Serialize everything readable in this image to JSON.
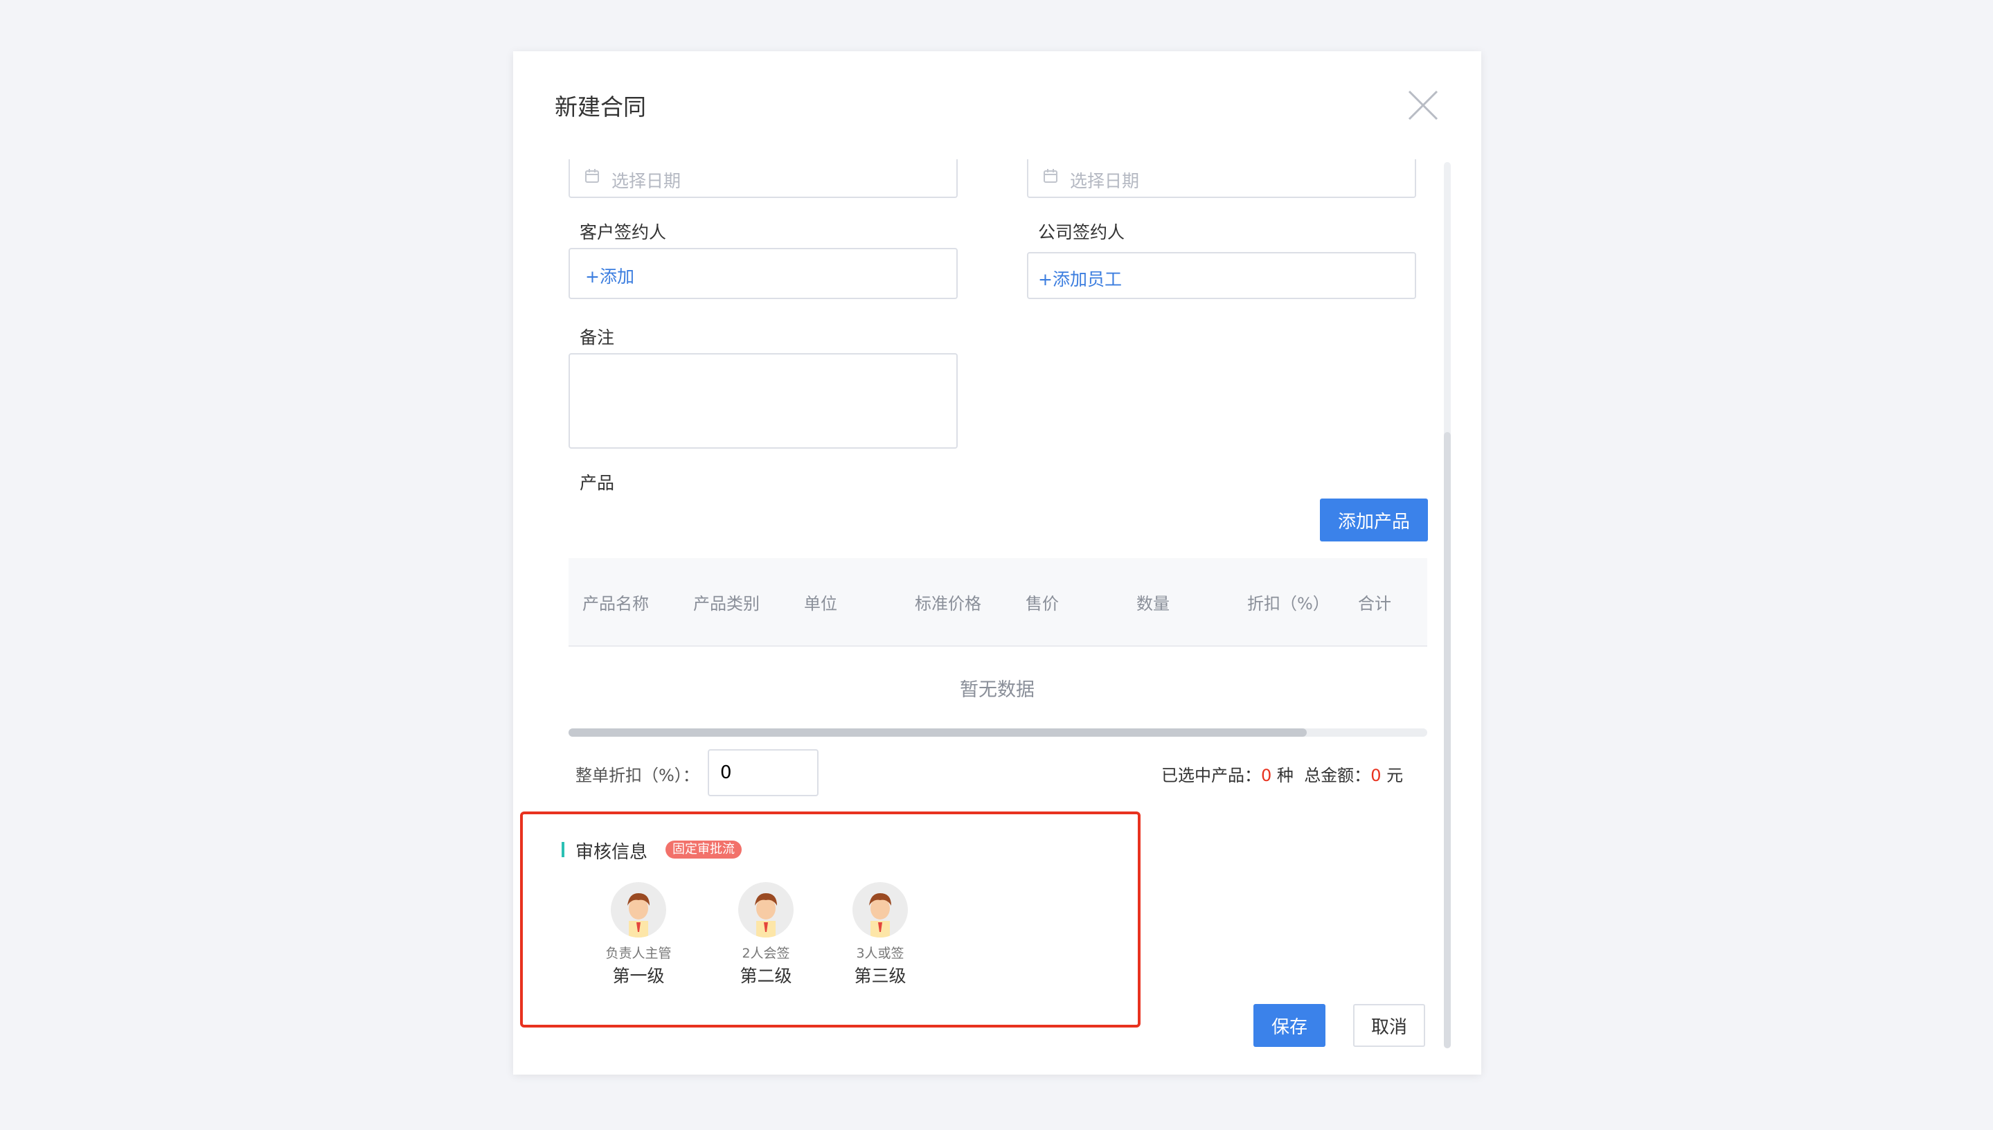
{
  "modal": {
    "title": "新建合同",
    "close_icon": "close-icon"
  },
  "form": {
    "date_placeholder_left": "选择日期",
    "date_placeholder_right": "选择日期",
    "customer_signer_label": "客户签约人",
    "customer_signer_add": "+添加",
    "company_signer_label": "公司签约人",
    "company_signer_add": "+添加员工",
    "remark_label": "备注",
    "remark_value": "",
    "product_label": "产品",
    "add_product_button": "添加产品"
  },
  "table": {
    "columns": [
      "产品名称",
      "产品类别",
      "单位",
      "标准价格",
      "售价",
      "数量",
      "折扣（%）",
      "合计"
    ],
    "empty_text": "暂无数据"
  },
  "summary": {
    "discount_label": "整单折扣（%）：",
    "discount_value": "0",
    "selected_label": "已选中产品：",
    "selected_count": "0",
    "selected_unit": "种",
    "total_label": "总金额：",
    "total_value": "0",
    "total_unit": "元"
  },
  "review": {
    "title": "审核信息",
    "tag": "固定审批流",
    "steps": [
      {
        "sub": "负责人主管",
        "level": "第一级"
      },
      {
        "sub": "2人会签",
        "level": "第二级"
      },
      {
        "sub": "3人或签",
        "level": "第三级"
      }
    ]
  },
  "footer": {
    "save_label": "保存",
    "cancel_label": "取消"
  },
  "colors": {
    "primary": "#3b82ea",
    "highlight_border": "#e8321f",
    "tag": "#f2716a",
    "accent_bar": "#2bc0b4"
  }
}
